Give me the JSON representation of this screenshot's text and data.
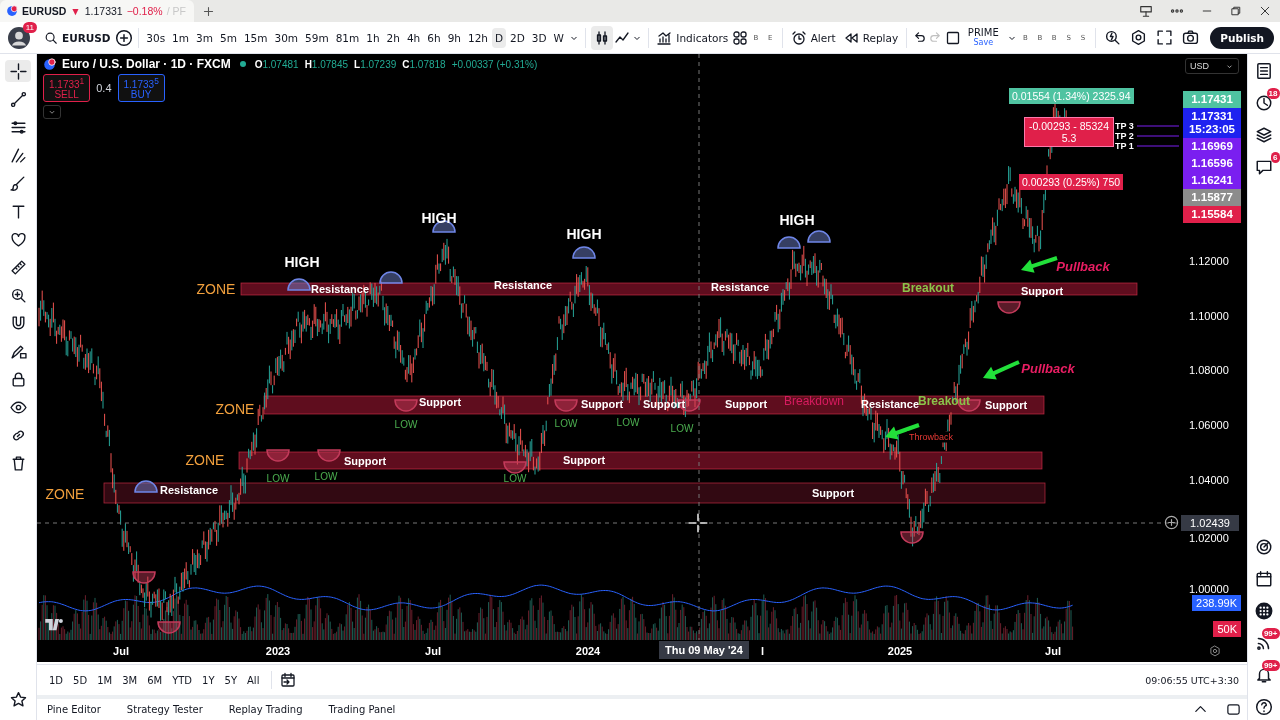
{
  "browser_tab": {
    "symbol": "EURUSD",
    "arrow": "▼",
    "price": "1.17331",
    "change": "−0.18%",
    "suffix": "/ PF"
  },
  "toolbar": {
    "notification_count": "11",
    "symbol": "EURUSD",
    "intervals": [
      {
        "label": "30s",
        "selected": false
      },
      {
        "label": "1m",
        "selected": false
      },
      {
        "label": "3m",
        "selected": false
      },
      {
        "label": "5m",
        "selected": false
      },
      {
        "label": "15m",
        "selected": false
      },
      {
        "label": "30m",
        "selected": false
      },
      {
        "label": "59m",
        "selected": false
      },
      {
        "label": "81m",
        "selected": false
      },
      {
        "label": "1h",
        "selected": false
      },
      {
        "label": "2h",
        "selected": false
      },
      {
        "label": "4h",
        "selected": false
      },
      {
        "label": "6h",
        "selected": false
      },
      {
        "label": "9h",
        "selected": false
      },
      {
        "label": "12h",
        "selected": false
      },
      {
        "label": "D",
        "selected": true
      },
      {
        "label": "2D",
        "selected": false
      },
      {
        "label": "3D",
        "selected": false
      },
      {
        "label": "W",
        "selected": false
      }
    ],
    "indicators": "Indicators",
    "quick_buttons": [
      "B",
      "E"
    ],
    "alert": "Alert",
    "replay": "Replay",
    "layout_name": "PRIME",
    "layout_action": "Save",
    "more_buttons": [
      "B",
      "B",
      "B",
      "S",
      "S"
    ],
    "publish": "Publish"
  },
  "drawing_tools": [
    {
      "kind": "crosshair",
      "selected": true
    },
    {
      "kind": "trendline",
      "selected": false
    },
    {
      "kind": "hlines",
      "selected": false
    },
    {
      "kind": "fork",
      "selected": false
    },
    {
      "kind": "brush",
      "selected": false
    },
    {
      "kind": "text",
      "selected": false
    },
    {
      "kind": "heart",
      "selected": false
    },
    {
      "kind": "ruler",
      "selected": false
    },
    {
      "kind": "zoom",
      "selected": false
    },
    {
      "kind": "magnet",
      "selected": false
    },
    {
      "kind": "pencil_lock",
      "selected": false
    },
    {
      "kind": "lock",
      "selected": false
    },
    {
      "kind": "eye",
      "selected": false
    },
    {
      "kind": "link",
      "selected": false
    },
    {
      "kind": "trash",
      "selected": false
    }
  ],
  "chart": {
    "legend": {
      "title": "Euro / U.S. Dollar · 1D · FXCM",
      "ohlc": [
        {
          "key": "O",
          "value": "1.07481"
        },
        {
          "key": "H",
          "value": "1.07845"
        },
        {
          "key": "L",
          "value": "1.07239"
        },
        {
          "key": "C",
          "value": "1.07818"
        }
      ],
      "change": "+0.00337 (+0.31%)",
      "sell_price": "1.1733$^{1}$",
      "sell_label": "SELL",
      "spread": "0.4",
      "buy_price": "1.1733$^{5}$",
      "buy_label": "BUY"
    },
    "currency": "USD",
    "annotations": [
      {
        "kind": "zone",
        "text": "ZONE"
      },
      {
        "kind": "high",
        "text": "HIGH"
      },
      {
        "kind": "resistance",
        "text": "Resistance"
      },
      {
        "kind": "high",
        "text": "HIGH"
      },
      {
        "kind": "resistance",
        "text": "Resistance"
      },
      {
        "kind": "high",
        "text": "HIGH"
      },
      {
        "kind": "high",
        "text": "HIGH"
      },
      {
        "kind": "resistance",
        "text": "Resistance"
      },
      {
        "kind": "breakout",
        "text": "Breakout"
      },
      {
        "kind": "pullback",
        "text": "Pullback"
      },
      {
        "kind": "support",
        "text": "Support"
      },
      {
        "kind": "pullback",
        "text": "Pullback"
      },
      {
        "kind": "zone",
        "text": "ZONE"
      },
      {
        "kind": "support",
        "text": "Support"
      },
      {
        "kind": "support",
        "text": "Support"
      },
      {
        "kind": "support",
        "text": "Support"
      },
      {
        "kind": "support",
        "text": "Support"
      },
      {
        "kind": "breakdown",
        "text": "Breakdown"
      },
      {
        "kind": "resistance",
        "text": "Resistance"
      },
      {
        "kind": "breakout",
        "text": "Breakout"
      },
      {
        "kind": "support",
        "text": "Support"
      },
      {
        "kind": "low",
        "text": "LOW"
      },
      {
        "kind": "low",
        "text": "LOW"
      },
      {
        "kind": "low",
        "text": "LOW"
      },
      {
        "kind": "low",
        "text": "LOW"
      },
      {
        "kind": "throwback",
        "text": "Throwback"
      },
      {
        "kind": "zone",
        "text": "ZONE"
      },
      {
        "kind": "support",
        "text": "Support"
      },
      {
        "kind": "support",
        "text": "Support"
      },
      {
        "kind": "low",
        "text": "LOW"
      },
      {
        "kind": "low",
        "text": "LOW"
      },
      {
        "kind": "low",
        "text": "LOW"
      },
      {
        "kind": "zone",
        "text": "ZONE"
      },
      {
        "kind": "resistance",
        "text": "Resistance"
      },
      {
        "kind": "support",
        "text": "Support"
      }
    ],
    "position_tool": {
      "target": "0.01554 (1.34%) 2325.94",
      "stop": "-0.00293 - 85324",
      "stop_ratio": "5.3",
      "entry": "0.00293 (0.25%) 750"
    },
    "tp_labels": [
      "TP 3",
      "TP 2",
      "TP 1"
    ],
    "price_labels": [
      {
        "text": "1.17431",
        "color": "#4fc3a1"
      },
      {
        "text": "1.17331",
        "countdown": "15:23:05",
        "color": "#1e22f0"
      },
      {
        "text": "1.16969",
        "color": "#7a1ff0"
      },
      {
        "text": "1.16596",
        "color": "#7a1ff0"
      },
      {
        "text": "1.16241",
        "color": "#7a1ff0"
      },
      {
        "text": "1.15877",
        "color": "#8c8c8c"
      },
      {
        "text": "1.15584",
        "color": "#e0204a"
      }
    ],
    "price_ticks": [
      "1.12000",
      "1.10000",
      "1.08000",
      "1.06000",
      "1.04000",
      "1.02000",
      "1.00000"
    ],
    "crosshair_price": "1.02439",
    "volume_labels": [
      {
        "text": "238.99K",
        "color": "#2962ff"
      },
      {
        "text": "50K",
        "color": "#e0204a"
      }
    ],
    "time_ticks": [
      "Jul",
      "2023",
      "Jul",
      "2024",
      "l",
      "2025",
      "Jul"
    ],
    "crosshair_date": "Thu 09 May '24"
  },
  "right_sidebar": {
    "top": [
      {
        "kind": "watchlist"
      },
      {
        "kind": "alerts",
        "badge": "18"
      },
      {
        "kind": "layers"
      },
      {
        "kind": "chat",
        "badge": "6"
      }
    ],
    "bottom": [
      {
        "kind": "target"
      },
      {
        "kind": "calendar"
      },
      {
        "kind": "apps"
      },
      {
        "kind": "feed",
        "badge": "99+"
      },
      {
        "kind": "notifications",
        "badge": "99+"
      },
      {
        "kind": "help"
      }
    ]
  },
  "range_bar": {
    "ranges": [
      "1D",
      "5D",
      "1M",
      "3M",
      "6M",
      "YTD",
      "1Y",
      "5Y",
      "All"
    ],
    "clock": "09:06:55 UTC+3:30"
  },
  "bottom_panel": {
    "tabs": [
      "Pine Editor",
      "Strategy Tester",
      "Replay Trading",
      "Trading Panel"
    ]
  }
}
